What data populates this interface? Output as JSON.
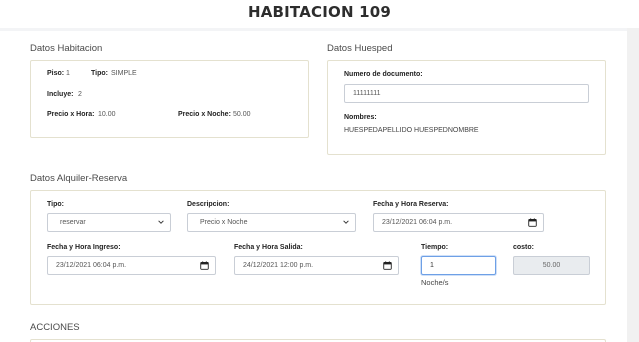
{
  "header": {
    "title": "HABITACION 109"
  },
  "datos_habitacion": {
    "title": "Datos Habitacion",
    "piso_label": "Piso:",
    "piso_value": "1",
    "tipo_label": "Tipo:",
    "tipo_value": "SIMPLE",
    "incluye_label": "Incluye:",
    "incluye_value": "2",
    "precio_hora_label": "Precio x Hora:",
    "precio_hora_value": "10.00",
    "precio_noche_label": "Precio x Noche:",
    "precio_noche_value": "50.00"
  },
  "datos_huesped": {
    "title": "Datos Huesped",
    "documento_label": "Numero de documento:",
    "documento_value": "11111111",
    "nombres_label": "Nombres:",
    "nombres_value": "HUESPEDAPELLIDO HUESPEDNOMBRE"
  },
  "alquiler": {
    "title": "Datos Alquiler-Reserva",
    "tipo_label": "Tipo:",
    "tipo_value": "reservar",
    "descripcion_label": "Descripcion:",
    "descripcion_value": "Precio x Noche",
    "fecha_reserva_label": "Fecha y Hora Reserva:",
    "fecha_reserva_value": "23/12/2021 06:04 p.m.",
    "fecha_ingreso_label": "Fecha y Hora Ingreso:",
    "fecha_ingreso_value": "23/12/2021 06:04 p.m.",
    "fecha_salida_label": "Fecha y Hora Salida:",
    "fecha_salida_value": "24/12/2021 12:00 p.m.",
    "tiempo_label": "Tiempo:",
    "tiempo_value": "1",
    "tiempo_unit": "Noche/s",
    "costo_label": "costo:",
    "costo_value": "50.00"
  },
  "acciones": {
    "title": "ACCIONES"
  }
}
